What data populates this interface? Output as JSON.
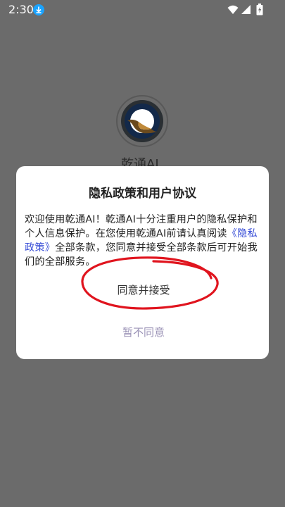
{
  "status_bar": {
    "time": "2:30",
    "icons": [
      "download-icon",
      "wifi-icon",
      "signal-icon",
      "battery-icon"
    ]
  },
  "background_app": {
    "name": "乾通AI",
    "logo_icon": "app-logo-icon"
  },
  "dialog": {
    "title": "隐私政策和用户协议",
    "body_before_link": "欢迎使用乾通AI！乾通AI十分注重用户的隐私保护和个人信息保护。在您使用乾通AI前请认真阅读",
    "policy_link": "《隐私政策》",
    "body_after_link": "全部条款，您同意并接受全部条款后可开始我们的全部服务。",
    "accept_label": "同意并接受",
    "decline_label": "暂不同意"
  },
  "colors": {
    "overlay": "#6b6b6b",
    "link": "#3a4fd7",
    "decline_text": "#9a92b6",
    "annotation": "#e0141e"
  }
}
